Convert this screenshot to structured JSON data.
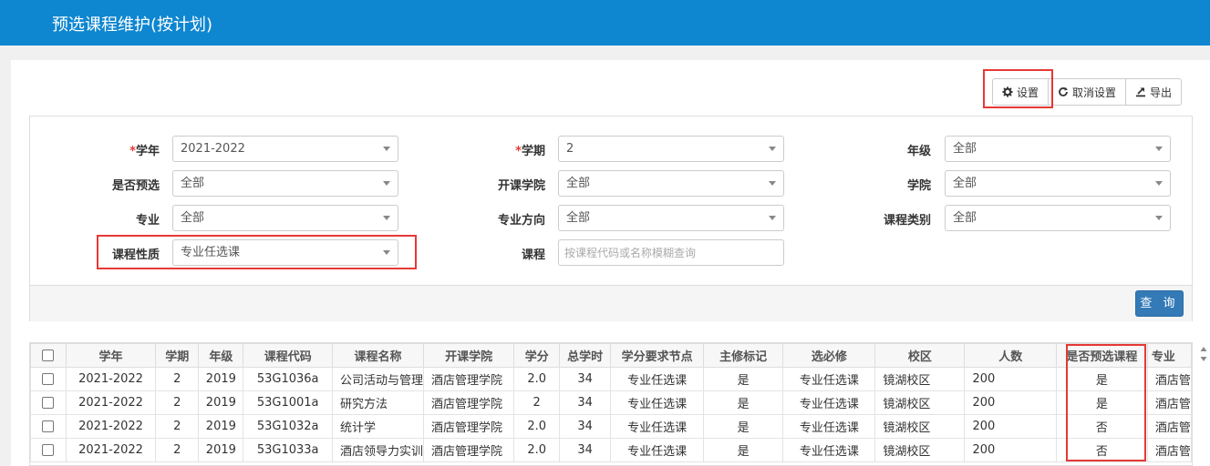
{
  "header": {
    "title": "预选课程维护(按计划)"
  },
  "toolbar": {
    "settings_label": "设置",
    "cancel_settings_label": "取消设置",
    "export_label": "导出"
  },
  "filters": {
    "year": {
      "label": "学年",
      "value": "2021-2022"
    },
    "term": {
      "label": "学期",
      "value": "2"
    },
    "grade": {
      "label": "年级",
      "value": "全部"
    },
    "preselect": {
      "label": "是否预选",
      "value": "全部"
    },
    "college_offering": {
      "label": "开课学院",
      "value": "全部"
    },
    "college": {
      "label": "学院",
      "value": "全部"
    },
    "major": {
      "label": "专业",
      "value": "全部"
    },
    "direction": {
      "label": "专业方向",
      "value": "全部"
    },
    "course_category": {
      "label": "课程类别",
      "value": "全部"
    },
    "course_nature": {
      "label": "课程性质",
      "value": "专业任选课"
    },
    "course": {
      "label": "课程",
      "placeholder": "按课程代码或名称模糊查询"
    },
    "required_mark": "*",
    "query_label": "查 询"
  },
  "table": {
    "columns": [
      "学年",
      "学期",
      "年级",
      "课程代码",
      "课程名称",
      "开课学院",
      "学分",
      "总学时",
      "学分要求节点",
      "主修标记",
      "选必修",
      "校区",
      "人数",
      "是否预选课程",
      "专业"
    ],
    "rows": [
      [
        "2021-2022",
        "2",
        "2019",
        "53G1036a",
        "公司活动与管理",
        "酒店管理学院",
        "2.0",
        "34",
        "专业任选课",
        "是",
        "专业任选课",
        "镜湖校区",
        "200",
        "是",
        "酒店管"
      ],
      [
        "2021-2022",
        "2",
        "2019",
        "53G1001a",
        "研究方法",
        "酒店管理学院",
        "2",
        "34",
        "专业任选课",
        "是",
        "专业任选课",
        "镜湖校区",
        "200",
        "是",
        "酒店管"
      ],
      [
        "2021-2022",
        "2",
        "2019",
        "53G1032a",
        "统计学",
        "酒店管理学院",
        "2.0",
        "34",
        "专业任选课",
        "是",
        "专业任选课",
        "镜湖校区",
        "200",
        "否",
        "酒店管"
      ],
      [
        "2021-2022",
        "2",
        "2019",
        "53G1033a",
        "酒店领导力实训",
        "酒店管理学院",
        "2.0",
        "34",
        "专业任选课",
        "是",
        "专业任选课",
        "镜湖校区",
        "200",
        "否",
        "酒店管"
      ]
    ]
  },
  "colors": {
    "header_bg": "#0e86d0",
    "highlight": "#e53935",
    "primary_button": "#337ab7"
  }
}
